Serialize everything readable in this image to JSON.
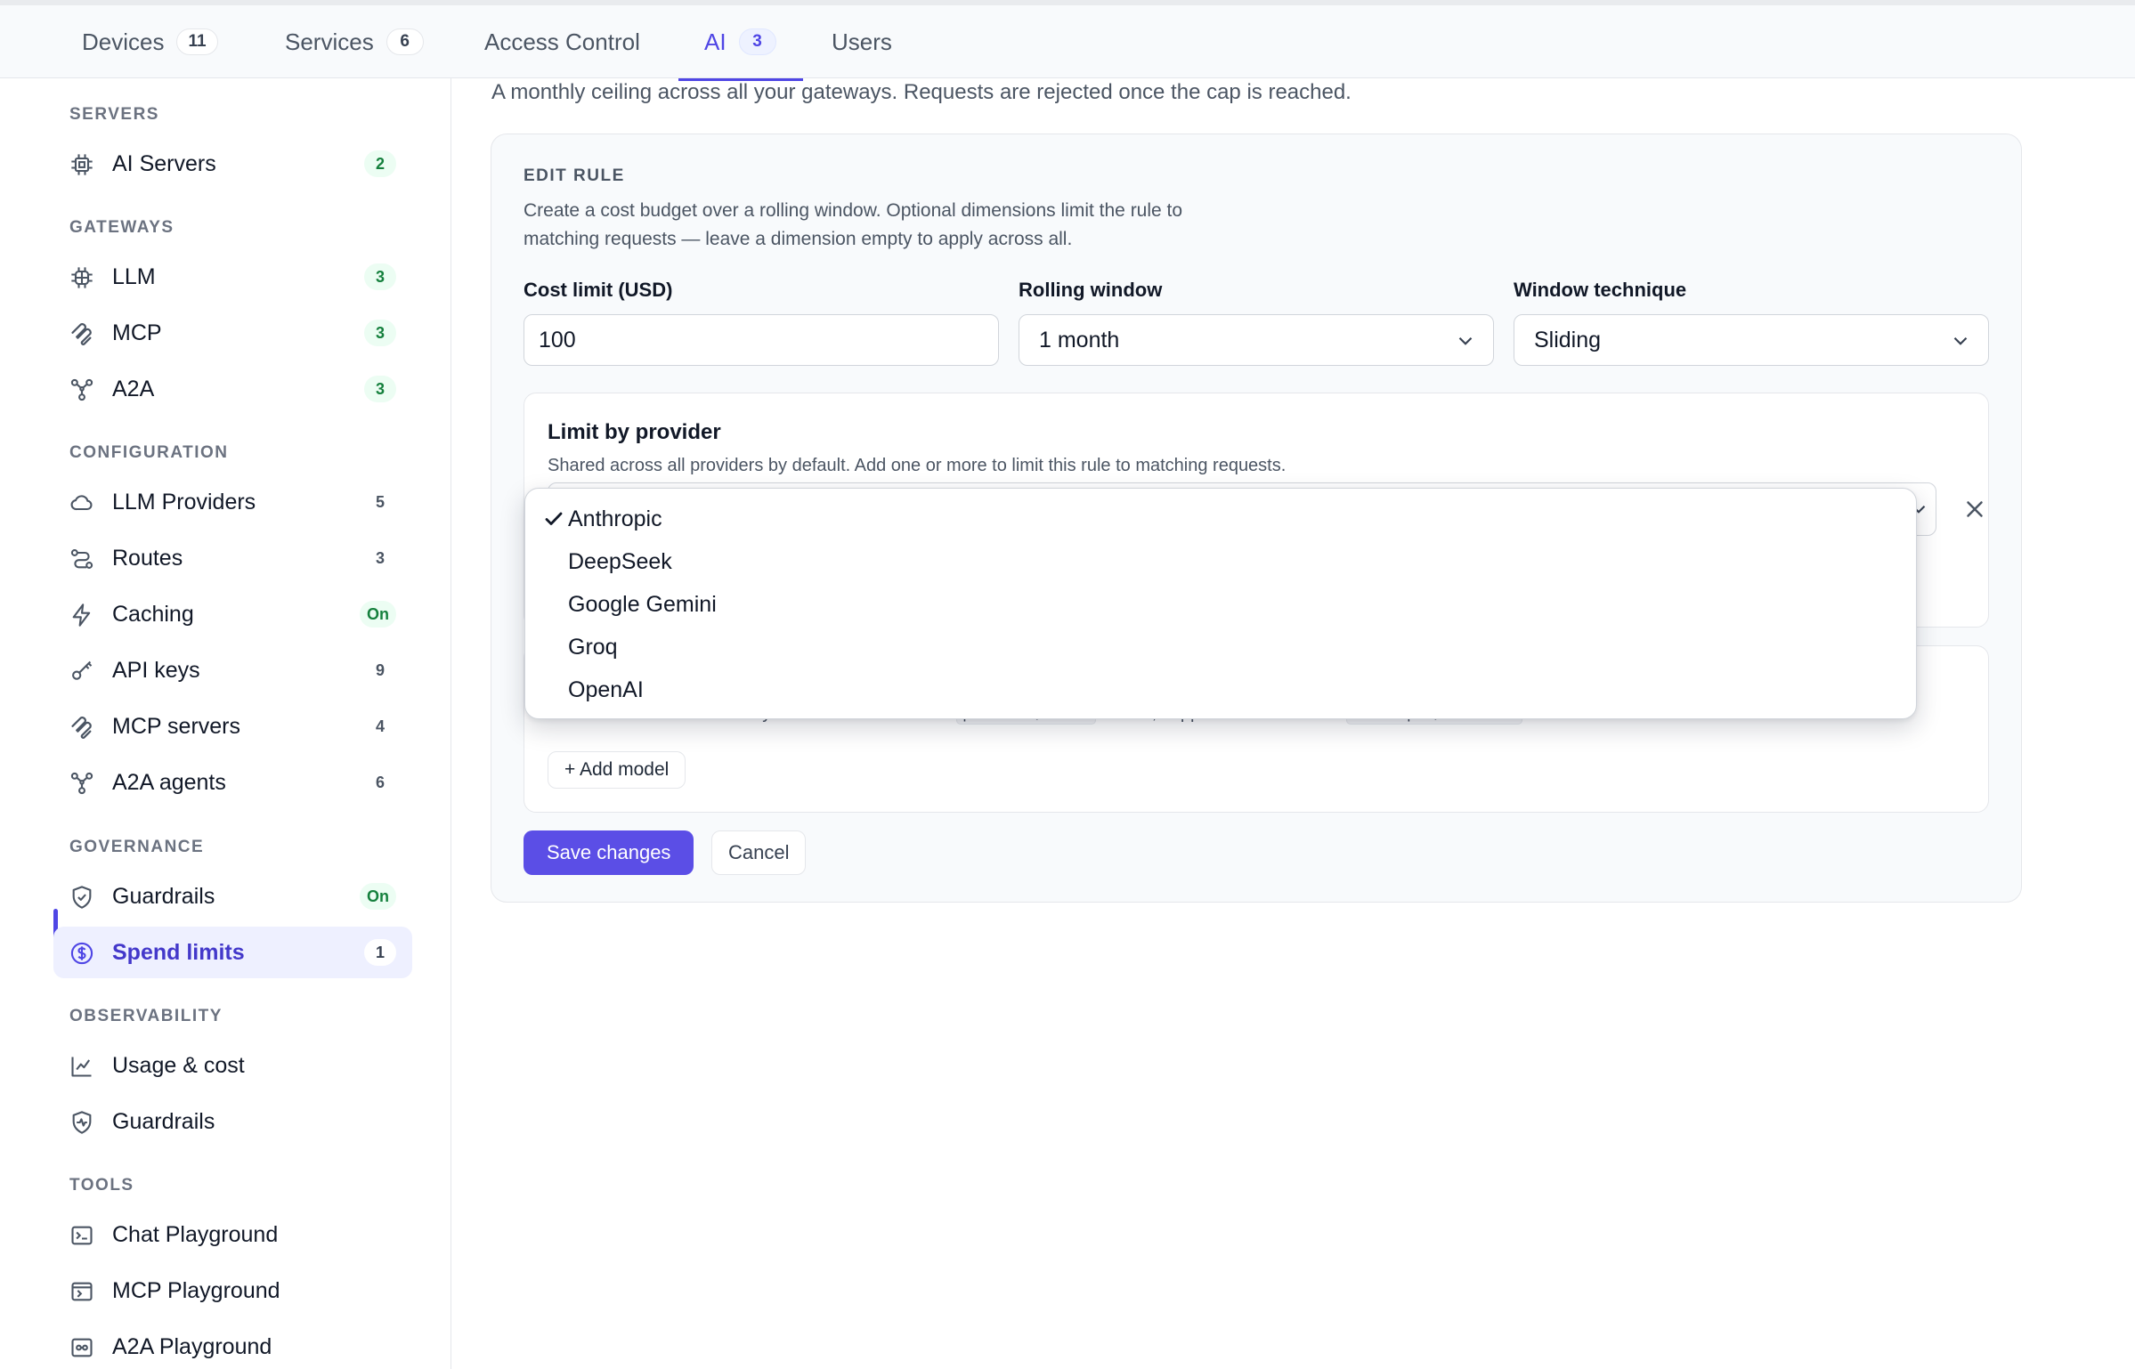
{
  "tabs": [
    {
      "label": "Devices",
      "count": "11"
    },
    {
      "label": "Services",
      "count": "6"
    },
    {
      "label": "Access Control"
    },
    {
      "label": "AI",
      "count": "3",
      "active": true
    },
    {
      "label": "Users"
    }
  ],
  "sidebar": {
    "sections": {
      "servers": "SERVERS",
      "gateways": "GATEWAYS",
      "configuration": "CONFIGURATION",
      "governance": "GOVERNANCE",
      "observability": "OBSERVABILITY",
      "tools": "TOOLS"
    },
    "items": {
      "ai_servers": {
        "label": "AI Servers",
        "badge": "2",
        "icon": "chip-icon"
      },
      "llm": {
        "label": "LLM",
        "badge": "3",
        "icon": "chip-icon"
      },
      "mcp": {
        "label": "MCP",
        "badge": "3",
        "icon": "mcp-icon"
      },
      "a2a": {
        "label": "A2A",
        "badge": "3",
        "icon": "network-icon"
      },
      "llm_providers": {
        "label": "LLM Providers",
        "badge": "5",
        "icon": "cloud-icon"
      },
      "routes": {
        "label": "Routes",
        "badge": "3",
        "icon": "route-icon"
      },
      "caching": {
        "label": "Caching",
        "badge": "On",
        "icon": "bolt-icon"
      },
      "api_keys": {
        "label": "API keys",
        "badge": "9",
        "icon": "key-icon"
      },
      "mcp_servers": {
        "label": "MCP servers",
        "badge": "4",
        "icon": "mcp-icon"
      },
      "a2a_agents": {
        "label": "A2A agents",
        "badge": "6",
        "icon": "network-icon"
      },
      "guardrails": {
        "label": "Guardrails",
        "badge": "On",
        "icon": "shield-check-icon"
      },
      "spend_limits": {
        "label": "Spend limits",
        "badge": "1",
        "icon": "dollar-circle-icon",
        "active": true
      },
      "usage_cost": {
        "label": "Usage & cost",
        "icon": "chart-line-icon"
      },
      "obs_guardrails": {
        "label": "Guardrails",
        "icon": "shield-pulse-icon"
      },
      "chat_playground": {
        "label": "Chat Playground",
        "icon": "terminal-icon"
      },
      "mcp_playground": {
        "label": "MCP Playground",
        "icon": "terminal-icon"
      },
      "a2a_playground": {
        "label": "A2A Playground",
        "icon": "link-box-icon"
      }
    }
  },
  "main": {
    "intro": "A monthly ceiling across all your gateways. Requests are rejected once the cap is reached.",
    "edit_rule": {
      "title": "EDIT RULE",
      "description": "Create a cost budget over a rolling window. Optional dimensions limit the rule to matching requests — leave a dimension empty to apply across all.",
      "cost_limit": {
        "label": "Cost limit (USD)",
        "value": "100"
      },
      "rolling_window": {
        "label": "Rolling window",
        "value": "1 month"
      },
      "window_technique": {
        "label": "Window technique",
        "value": "Sliding"
      },
      "provider_panel": {
        "title": "Limit by provider",
        "description": "Shared across all providers by default. Add one or more to limit this rule to matching requests."
      },
      "model_panel": {
        "desc_prefix": "Shared across all models by default. Add models in",
        "code_format": "provider/model",
        "desc_middle": "format, supports wildcards like",
        "code_example": "anthropic/claude-*",
        "desc_suffix": ".",
        "add_label": "+ Add model"
      },
      "save_label": "Save changes",
      "cancel_label": "Cancel"
    },
    "provider_dropdown": {
      "selected": "Anthropic",
      "options": [
        "Anthropic",
        "DeepSeek",
        "Google Gemini",
        "Groq",
        "OpenAI"
      ]
    }
  },
  "colors": {
    "accent": "#4f46e5",
    "primary_button": "#5b4ee6",
    "badge_green_bg": "#ecfdf3",
    "badge_green_text": "#15803d"
  }
}
